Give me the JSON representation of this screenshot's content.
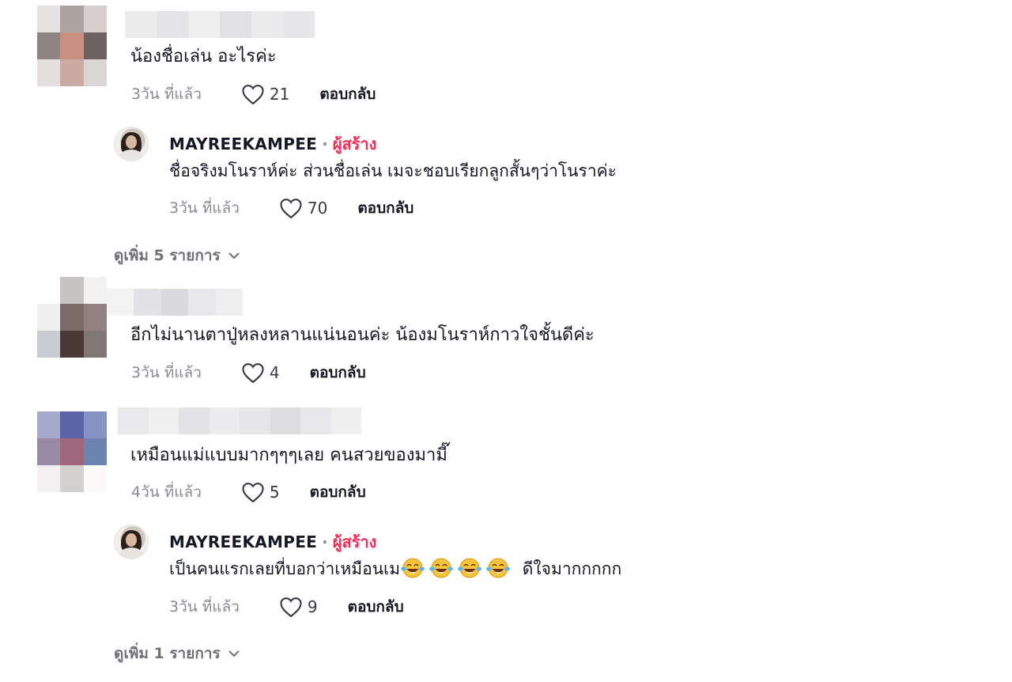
{
  "labels": {
    "reply": "ตอบกลับ",
    "creator": "ผู้สร้าง"
  },
  "comments": [
    {
      "text": "น้องชื่อเล่น อะไรค่ะ",
      "time": "3วัน ที่แล้ว",
      "likes": "21",
      "replies": [
        {
          "author": "MAYREEKAMPEE",
          "text": "ชื่อจริงมโนราห์ค่ะ ส่วนชื่อเล่น เมจะชอบเรียกลูกสั้นๆว่าโนราค่ะ",
          "time": "3วัน ที่แล้ว",
          "likes": "70"
        }
      ],
      "more_label": "ดูเพิ่ม 5 รายการ"
    },
    {
      "text": "อีกไม่นานตาปู่หลงหลานแน่นอนค่ะ น้องมโนราห์กาวใจชั้นดีค่ะ",
      "time": "3วัน ที่แล้ว",
      "likes": "4"
    },
    {
      "text": "เหมือนแม่แบบมากๆๆๆเลย คนสวยของมามี๊",
      "time": "4วัน ที่แล้ว",
      "likes": "5",
      "replies": [
        {
          "author": "MAYREEKAMPEE",
          "text_before": "เป็นคนแรกเลยที่บอกว่าเหมือนเม",
          "text_after": "ดีใจมากกกกก",
          "emoji": "face-with-tears-of-joy-icon",
          "emoji_count": 4,
          "time": "3วัน ที่แล้ว",
          "likes": "9"
        }
      ],
      "more_label": "ดูเพิ่ม 1 รายการ"
    }
  ],
  "colors": {
    "creator": "#fe2c55",
    "muted": "#8a8b91",
    "text": "#161823"
  }
}
